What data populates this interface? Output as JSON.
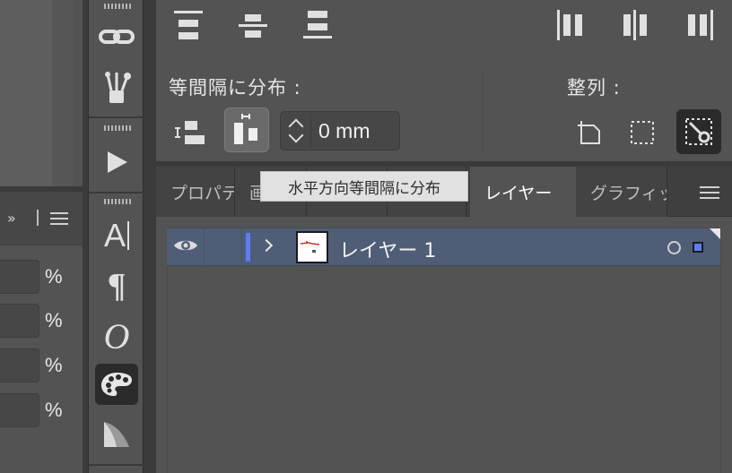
{
  "left_panel": {
    "more_label": "»",
    "percent_fields": [
      {
        "value": "",
        "unit": "%"
      },
      {
        "value": "",
        "unit": "%"
      },
      {
        "value": "",
        "unit": "%"
      },
      {
        "value": "",
        "unit": "%"
      }
    ]
  },
  "toolbar": {
    "tools": [
      {
        "name": "link-icon"
      },
      {
        "name": "brushes-icon"
      },
      {
        "name": "play-icon"
      },
      {
        "name": "character-icon",
        "label": "A"
      },
      {
        "name": "paragraph-icon",
        "label": "¶"
      },
      {
        "name": "opentype-icon",
        "label": "O"
      },
      {
        "name": "color-palette-icon",
        "active": true
      },
      {
        "name": "gradient-icon"
      }
    ]
  },
  "align_panel": {
    "distribute_spacing_title": "等間隔に分布 :",
    "align_to_title": "整列 :",
    "spacing_value": "0 mm",
    "tooltip": "水平方向等間隔に分布"
  },
  "tabs": [
    {
      "label": "プロパティ",
      "active": false
    },
    {
      "label": "画",
      "active": false
    },
    {
      "label": "",
      "active": false
    },
    {
      "label": "",
      "active": false
    },
    {
      "label": "レイヤー",
      "active": true
    },
    {
      "label": "グラフィックスタイル",
      "active": false
    }
  ],
  "layers": [
    {
      "name": "レイヤー 1",
      "color": "#5c7cf7",
      "visible": true,
      "selected": true
    }
  ],
  "colors": {
    "layer_highlight": "#4f5e76",
    "layer_color": "#5c7cf7",
    "panel_bg": "#535353"
  }
}
